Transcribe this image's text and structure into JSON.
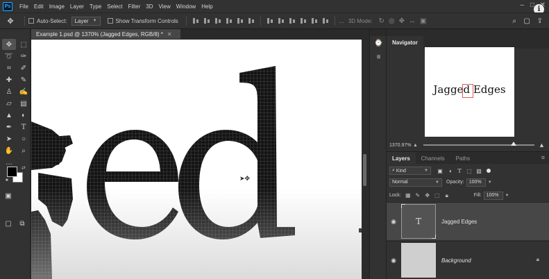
{
  "app": {
    "logo": "Ps"
  },
  "menu": [
    "File",
    "Edit",
    "Image",
    "Layer",
    "Type",
    "Select",
    "Filter",
    "3D",
    "View",
    "Window",
    "Help"
  ],
  "window": {
    "minimize": "–",
    "maximize": "□",
    "close": "✕",
    "info": "i"
  },
  "options": {
    "auto_select_label": "Auto-Select:",
    "auto_select_target": "Layer",
    "show_transform_label": "Show Transform Controls",
    "mode_3d_label": "3D Mode:"
  },
  "document": {
    "tab_title": "Example 1.psd @ 1370% (Jagged Edges, RGB/8) *",
    "close": "✕"
  },
  "navigator": {
    "tab_label": "Navigator",
    "preview_text": "Jagged Edges",
    "zoom": "1370.97%"
  },
  "layers_panel": {
    "tabs": [
      "Layers",
      "Channels",
      "Paths"
    ],
    "kind_label": "Kind",
    "blend_mode": "Normal",
    "opacity_label": "Opacity:",
    "opacity_value": "100%",
    "lock_label": "Lock:",
    "fill_label": "Fill:",
    "fill_value": "100%",
    "layers": [
      {
        "name": "Jagged Edges",
        "type": "text",
        "thumb_glyph": "T",
        "selected": true
      },
      {
        "name": "Background",
        "type": "raster",
        "locked": true,
        "selected": false
      }
    ]
  },
  "colors": {
    "foreground": "#000000",
    "background": "#ffffff",
    "accent": "#31a8ff"
  },
  "tool_icons": [
    "move-icon",
    "marquee-icon",
    "lasso-icon",
    "quick-select-icon",
    "crop-icon",
    "eyedropper-icon",
    "healing-icon",
    "brush-icon",
    "stamp-icon",
    "history-brush-icon",
    "eraser-icon",
    "gradient-icon",
    "blur-icon",
    "dodge-icon",
    "pen-icon",
    "type-icon",
    "path-select-icon",
    "shape-icon",
    "hand-icon",
    "zoom-icon"
  ]
}
